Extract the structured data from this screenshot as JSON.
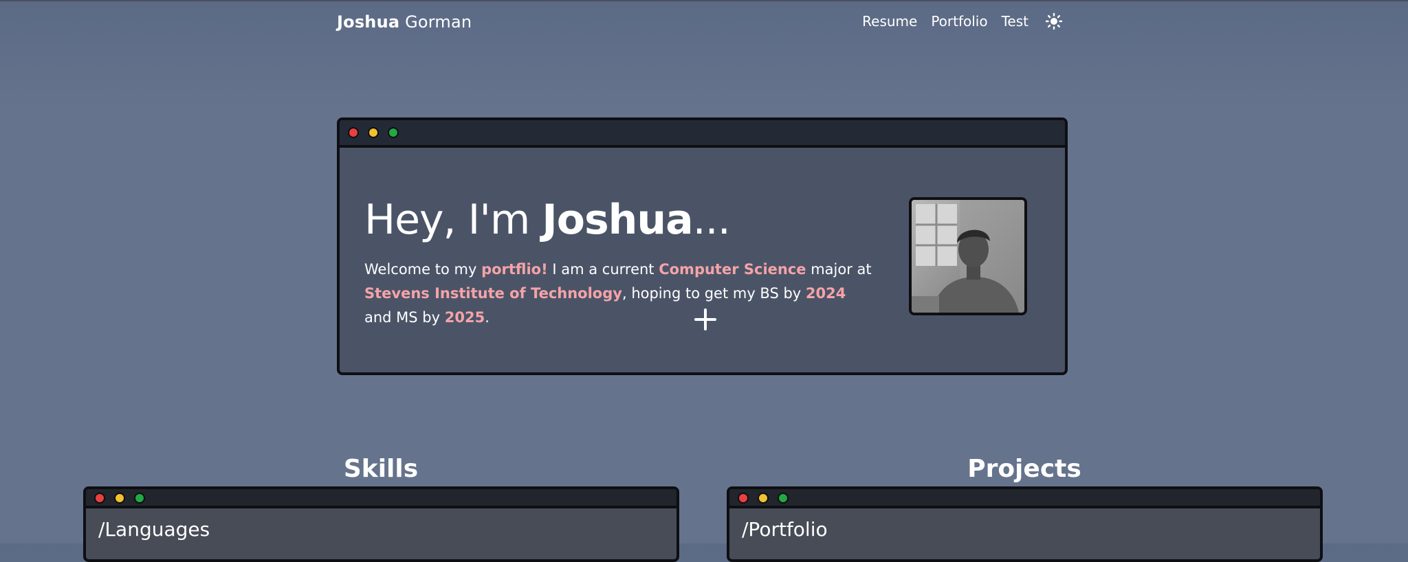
{
  "nav": {
    "brand_first": "Joshua",
    "brand_last": " Gorman",
    "links": [
      "Resume",
      "Portfolio",
      "Test"
    ],
    "theme_icon": "sun-icon"
  },
  "hero": {
    "title_prefix": "Hey, I'm ",
    "title_name": "Joshua",
    "title_suffix": "...",
    "text": {
      "t1": "Welcome to my ",
      "h1": "portflio!",
      "t2": " I am a current ",
      "h2": "Computer Science",
      "t3": " major at ",
      "h3": "Stevens Institute of Technology",
      "t4": ", hoping to get my BS by ",
      "h4": "2024",
      "t5": " and MS by ",
      "h5": "2025",
      "t6": "."
    },
    "expand_icon": "plus-icon"
  },
  "skills": {
    "heading": "Skills",
    "path": "/Languages"
  },
  "projects": {
    "heading": "Projects",
    "path": "/Portfolio"
  },
  "colors": {
    "accent": "#f5a3a8",
    "background": "#66738d",
    "window_body": "#4b5467",
    "titlebar": "#242a35",
    "dot_red": "#e94040",
    "dot_yellow": "#f2c12e",
    "dot_green": "#22a845"
  }
}
